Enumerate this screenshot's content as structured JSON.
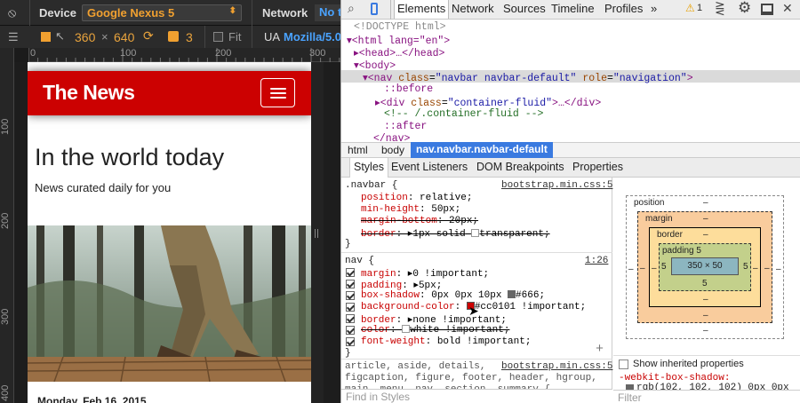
{
  "left_panel": {
    "device_label": "Device",
    "device_value": "Google Nexus 5",
    "network_label": "Network",
    "network_value": "No t",
    "width": "360",
    "times": "×",
    "height": "640",
    "pixel_ratio": "3",
    "fit_label": "Fit",
    "ua_label": "UA",
    "ua_value": "Mozilla/5.0",
    "ruler_top": [
      "0",
      "100",
      "200",
      "300"
    ],
    "ruler_left": [
      "100",
      "200",
      "300",
      "400"
    ]
  },
  "page": {
    "brand": "The News",
    "headline": "In the world today",
    "subline": "News curated daily for you",
    "date": "Monday, Feb 16, 2015"
  },
  "devtools": {
    "tabs": [
      "Elements",
      "Network",
      "Sources",
      "Timeline",
      "Profiles"
    ],
    "more": "»",
    "warnings": "1",
    "dom": {
      "doctype": "<!DOCTYPE html>",
      "html_tag": "<html lang=\"en\">",
      "head": "<head>…</head>",
      "body": "<body>",
      "nav_tag": "<nav",
      "nav_class_attr": "class",
      "nav_class_val": "\"navbar navbar-default\"",
      "nav_role_attr": "role",
      "nav_role_val": "\"navigation\"",
      "before": "::before",
      "div_tag": "<div",
      "div_class_attr": "class",
      "div_class_val": "\"container-fluid\"",
      "div_end": ">…</div>",
      "comment": "<!-- /.container-fluid -->",
      "after": "::after",
      "nav_close": "</nav>"
    },
    "crumbs": [
      "html",
      "body",
      "nav.navbar.navbar-default"
    ],
    "subtabs": [
      "Styles",
      "Event Listeners",
      "DOM Breakpoints",
      "Properties"
    ],
    "rule1": {
      "selector": ".navbar {",
      "source": "bootstrap.min.css:5",
      "props": [
        {
          "name": "position",
          "value": "relative;"
        },
        {
          "name": "min-height",
          "value": "50px;"
        },
        {
          "name": "margin-bottom",
          "value": "20px;"
        },
        {
          "name": "border",
          "value": "1px solid",
          "value2": "transparent;"
        }
      ],
      "close": "}"
    },
    "rule2": {
      "selector": "nav {",
      "source": "1:26",
      "props": [
        {
          "name": "margin",
          "value": "0 !important;"
        },
        {
          "name": "padding",
          "value": "5px;"
        },
        {
          "name": "box-shadow",
          "value": "0px 0px 10px",
          "value2": "#666;"
        },
        {
          "name": "background-color",
          "value": "#cc0101 !important;"
        },
        {
          "name": "border",
          "value": "none !important;"
        },
        {
          "name": "color",
          "value": "white !important;"
        },
        {
          "name": "font-weight",
          "value": "bold !important;"
        }
      ],
      "close": "}"
    },
    "rule3": {
      "line1": "article, aside, details,",
      "source": "bootstrap.min.css:5",
      "line2": "figcaption, figure, footer, header, hgroup,",
      "line3": "main, menu, nav, section, summary {"
    },
    "filter_placeholder": "Find in Styles",
    "boxmodel": {
      "position": "position",
      "margin": "margin",
      "border": "border",
      "padding": "padding",
      "padding_value": "5",
      "content": "350 × 50",
      "dash": "–",
      "five": "5"
    },
    "inherited_label": "Show inherited properties",
    "computed_prop": "-webkit-box-shadow:",
    "computed_val": "rgb(102, 102, 102) 0px 0px",
    "filter2": "Filter",
    "colors": {
      "accent_red": "#cc0101",
      "shadow": "#666666"
    }
  }
}
